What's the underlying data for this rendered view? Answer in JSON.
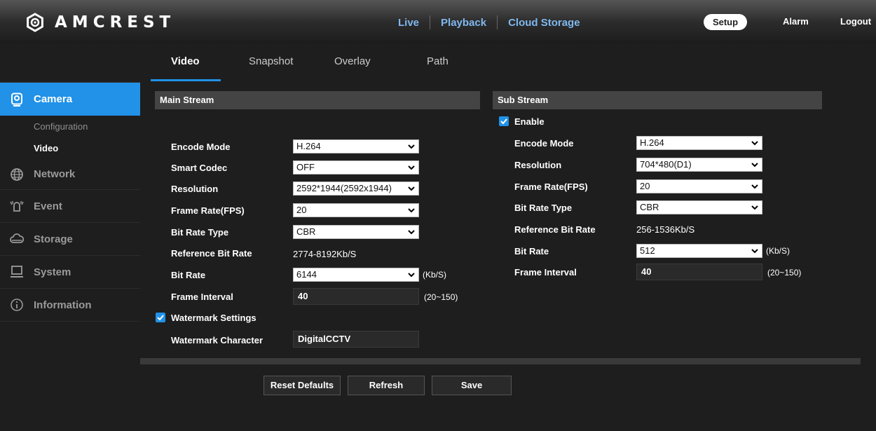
{
  "brand": "AMCREST",
  "nav": {
    "live": "Live",
    "playback": "Playback",
    "cloud": "Cloud Storage",
    "setup": "Setup",
    "alarm": "Alarm",
    "logout": "Logout"
  },
  "sidebar": {
    "camera": "Camera",
    "configuration": "Configuration",
    "video": "Video",
    "network": "Network",
    "event": "Event",
    "storage": "Storage",
    "system": "System",
    "information": "Information"
  },
  "tabs": {
    "video": "Video",
    "snapshot": "Snapshot",
    "overlay": "Overlay",
    "path": "Path"
  },
  "main": {
    "header": "Main Stream",
    "encode_mode_label": "Encode Mode",
    "encode_mode": "H.264",
    "smart_codec_label": "Smart Codec",
    "smart_codec": "OFF",
    "resolution_label": "Resolution",
    "resolution": "2592*1944(2592x1944)",
    "frame_rate_label": "Frame Rate(FPS)",
    "frame_rate": "20",
    "bit_rate_type_label": "Bit Rate Type",
    "bit_rate_type": "CBR",
    "ref_bit_rate_label": "Reference Bit Rate",
    "ref_bit_rate": "2774-8192Kb/S",
    "bit_rate_label": "Bit Rate",
    "bit_rate": "6144",
    "bit_rate_unit": "(Kb/S)",
    "frame_interval_label": "Frame Interval",
    "frame_interval": "40",
    "frame_interval_range": "(20~150)",
    "watermark_label": "Watermark Settings",
    "watermark_char_label": "Watermark Character",
    "watermark_char": "DigitalCCTV"
  },
  "sub": {
    "header": "Sub Stream",
    "enable_label": "Enable",
    "encode_mode_label": "Encode Mode",
    "encode_mode": "H.264",
    "resolution_label": "Resolution",
    "resolution": "704*480(D1)",
    "frame_rate_label": "Frame Rate(FPS)",
    "frame_rate": "20",
    "bit_rate_type_label": "Bit Rate Type",
    "bit_rate_type": "CBR",
    "ref_bit_rate_label": "Reference Bit Rate",
    "ref_bit_rate": "256-1536Kb/S",
    "bit_rate_label": "Bit Rate",
    "bit_rate": "512",
    "bit_rate_unit": "(Kb/S)",
    "frame_interval_label": "Frame Interval",
    "frame_interval": "40",
    "frame_interval_range": "(20~150)"
  },
  "buttons": {
    "reset": "Reset Defaults",
    "refresh": "Refresh",
    "save": "Save"
  },
  "colors": {
    "accent": "#2192e8",
    "nav_link": "#7fb8ef",
    "panel": "#1e1e1e"
  }
}
